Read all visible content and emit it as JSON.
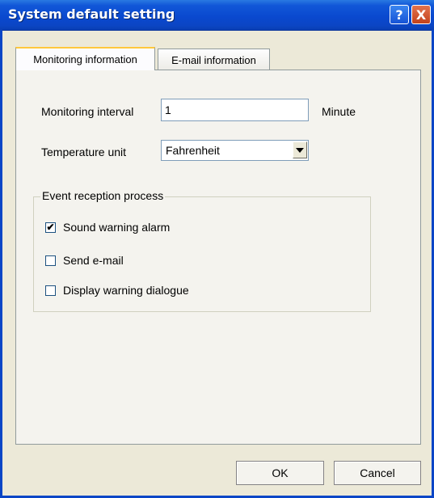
{
  "window": {
    "title": "System default setting",
    "help_label": "?",
    "close_label": "X"
  },
  "tabs": [
    {
      "label": "Monitoring information",
      "active": true
    },
    {
      "label": "E-mail information",
      "active": false
    }
  ],
  "monitoring": {
    "interval_label": "Monitoring interval",
    "interval_value": "1",
    "interval_unit": "Minute",
    "temperature_label": "Temperature unit",
    "temperature_value": "Fahrenheit"
  },
  "event_group": {
    "legend": "Event reception process",
    "options": [
      {
        "label": "Sound warning alarm",
        "checked": true
      },
      {
        "label": "Send e-mail",
        "checked": false
      },
      {
        "label": "Display warning dialogue",
        "checked": false
      }
    ]
  },
  "buttons": {
    "ok": "OK",
    "cancel": "Cancel"
  }
}
